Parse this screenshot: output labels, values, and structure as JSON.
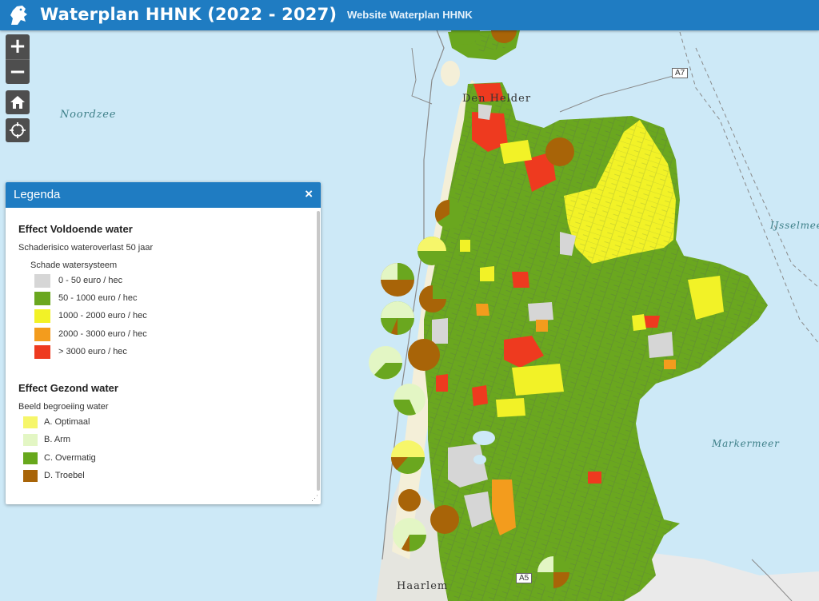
{
  "header": {
    "title": "Waterplan HHNK (2022 - 2027)",
    "website_link": "Website Waterplan HHNK"
  },
  "map_controls": {
    "zoom_in": "+",
    "zoom_out": "−"
  },
  "map_labels": {
    "sea_north": "Noordzee",
    "ijsselmeer": "IJsselmeer",
    "markermeer": "Markermeer",
    "city_denhelder": "Den Helder",
    "city_haarlem": "Haarlem",
    "road_a7": "A7",
    "road_a5": "A5"
  },
  "legend": {
    "title": "Legenda",
    "close": "×",
    "section1": {
      "title": "Effect Voldoende water",
      "subtitle": "Schaderisico wateroverlast 50 jaar",
      "group": "Schade watersysteem",
      "items": [
        {
          "label": "0 - 50 euro / hec",
          "color": "#d6d6d6"
        },
        {
          "label": "50 - 1000 euro / hec",
          "color": "#6aa71f"
        },
        {
          "label": "1000 - 2000 euro / hec",
          "color": "#f2f227"
        },
        {
          "label": "2000 - 3000 euro / hec",
          "color": "#f39c1d"
        },
        {
          "label": "> 3000 euro / hec",
          "color": "#ee3a1f"
        }
      ]
    },
    "section2": {
      "title": "Effect Gezond water",
      "subtitle": "Beeld begroeiing water",
      "items": [
        {
          "label": "A. Optimaal",
          "color": "#f6f66a"
        },
        {
          "label": "B. Arm",
          "color": "#e3f6c4"
        },
        {
          "label": "C. Overmatig",
          "color": "#67a81c"
        },
        {
          "label": "D. Troebel",
          "color": "#a86408"
        }
      ]
    }
  }
}
